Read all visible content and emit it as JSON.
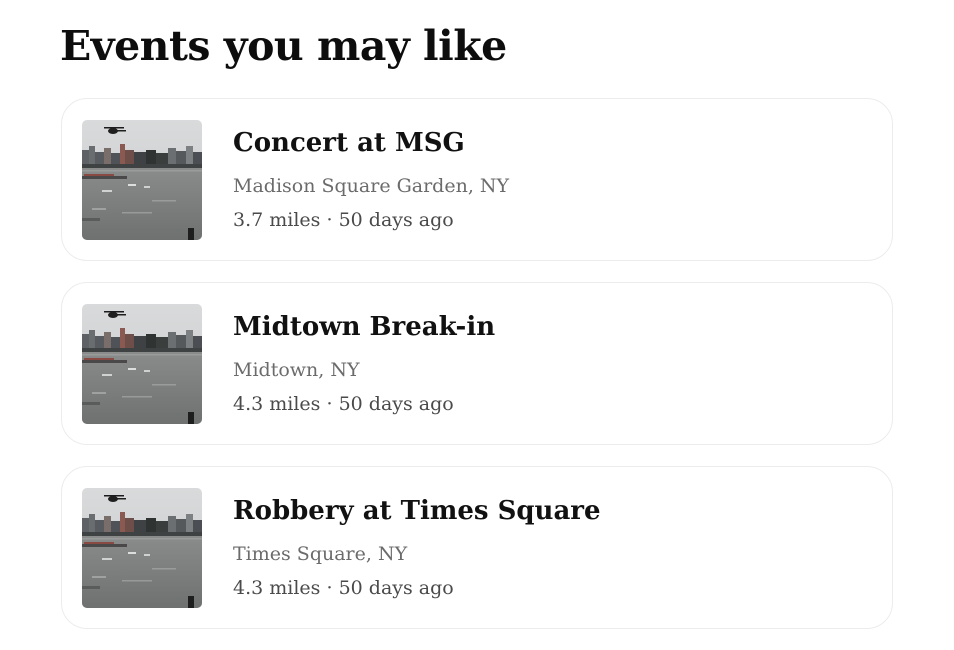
{
  "section": {
    "title": "Events you may like"
  },
  "events": [
    {
      "title": "Concert at MSG",
      "location": "Madison Square Garden, NY",
      "distance": "3.7 miles",
      "separator": "·",
      "time": "50 days ago"
    },
    {
      "title": "Midtown Break-in",
      "location": "Midtown, NY",
      "distance": "4.3 miles",
      "separator": "·",
      "time": "50 days ago"
    },
    {
      "title": "Robbery at Times Square",
      "location": "Times Square, NY",
      "distance": "4.3 miles",
      "separator": "·",
      "time": "50 days ago"
    }
  ],
  "thumbnail": {
    "icon": "river-helicopter-photo"
  }
}
